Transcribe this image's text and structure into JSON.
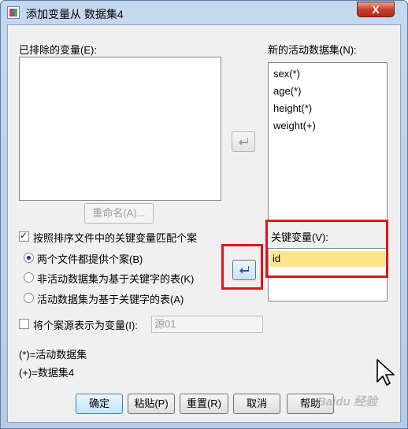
{
  "window": {
    "title": "添加变量从 数据集4",
    "close_label": "X"
  },
  "excluded": {
    "label": "已排除的变量(E):",
    "items": []
  },
  "new_dataset": {
    "label": "新的活动数据集(N):",
    "items": [
      "sex(*)",
      "age(*)",
      "height(*)",
      "weight(+)"
    ]
  },
  "rename_button": "重命名(A)...",
  "match_checkbox": {
    "label": "按照排序文件中的关键变量匹配个案",
    "checked": true
  },
  "radios": [
    {
      "label": "两个文件都提供个案(B)",
      "checked": true
    },
    {
      "label": "非活动数据集为基于关键字的表(K)",
      "checked": false
    },
    {
      "label": "活动数据集为基于关键字的表(A)",
      "checked": false
    }
  ],
  "key_variables": {
    "label": "关键变量(V):",
    "items": [
      "id"
    ]
  },
  "source_checkbox": {
    "label": "将个案源表示为变量(I):",
    "checked": false,
    "value": "源01"
  },
  "legend": {
    "line1": "(*)=活动数据集",
    "line2": "(+)=数据集4"
  },
  "buttons": {
    "ok": "确定",
    "paste": "粘贴(P)",
    "reset": "重置(R)",
    "cancel": "取消",
    "help": "帮助"
  },
  "watermark_text": "Baidu 经验",
  "colors": {
    "highlight_box": "#e0141e",
    "key_item_bg": "#ffe58a",
    "arrow_active": "#3a4fb8"
  }
}
